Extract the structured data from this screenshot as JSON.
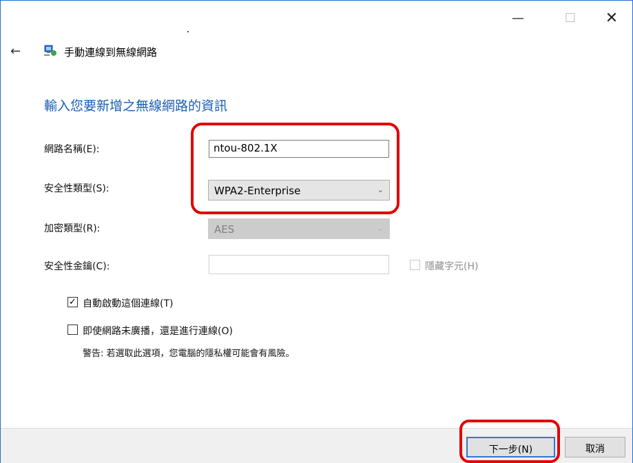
{
  "window": {
    "controls": {
      "minimize": "—",
      "maximize": "☐",
      "close": "✕"
    },
    "title": "手動連線到無線網路",
    "back_glyph": "←",
    "icon": "network-icon"
  },
  "heading": "輸入您要新增之無線網路的資訊",
  "form": {
    "network_name": {
      "label": "網路名稱(E):",
      "value": "ntou-802.1X"
    },
    "security_type": {
      "label": "安全性類型(S):",
      "value": "WPA2-Enterprise"
    },
    "encryption_type": {
      "label": "加密類型(R):",
      "value": "AES",
      "disabled": true
    },
    "security_key": {
      "label": "安全性金鑰(C):",
      "value": ""
    },
    "hide_chars": {
      "label": "隱藏字元(H)",
      "checked": false,
      "disabled": true
    }
  },
  "options": {
    "auto_connect": {
      "label": "自動啟動這個連線(T)",
      "checked": true
    },
    "connect_even_hidden": {
      "label": "即使網路未廣播，還是進行連線(O)",
      "checked": false
    },
    "warning": "警告: 若選取此選項，您電腦的隱私權可能會有風險。"
  },
  "footer": {
    "next": "下一步(N)",
    "cancel": "取消"
  },
  "colors": {
    "accent": "#1a5fb4",
    "highlight": "#e00000",
    "button_focus": "#2c78d6"
  }
}
